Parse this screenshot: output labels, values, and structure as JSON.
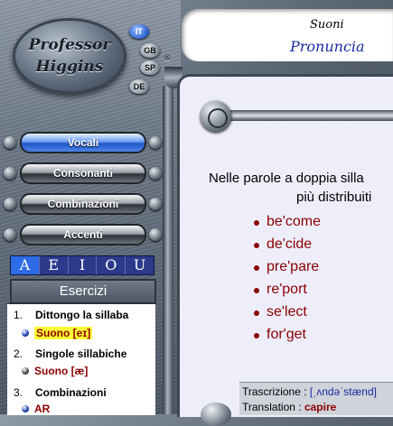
{
  "logo": {
    "line1": "Professor",
    "line2": "Higgins",
    "reg": "®"
  },
  "languages": [
    {
      "code": "IT",
      "active": true
    },
    {
      "code": "GB",
      "active": false
    },
    {
      "code": "SP",
      "active": false
    },
    {
      "code": "DE",
      "active": false
    }
  ],
  "nav": [
    {
      "label": "Vocali",
      "active": true
    },
    {
      "label": "Consonanti",
      "active": false
    },
    {
      "label": "Combinazioni",
      "active": false
    },
    {
      "label": "Accenti",
      "active": false
    }
  ],
  "letters": [
    "A",
    "E",
    "I",
    "O",
    "U"
  ],
  "selected_letter": "A",
  "esercizi_label": "Esercizi",
  "exercises": [
    {
      "num": "1.",
      "title": "Dittongo la sillaba",
      "sub": "Suono [eɪ]",
      "highlight": true
    },
    {
      "num": "2.",
      "title": "Singole sillabiche",
      "sub": "Suono [æ]",
      "highlight": false
    },
    {
      "num": "3.",
      "title": "Combinazioni",
      "sub": "AR",
      "highlight": false
    }
  ],
  "header": {
    "subtitle": "Suoni",
    "title": "Pronuncia"
  },
  "instruction": {
    "line1": "Nelle parole a doppia silla",
    "line2": "più distribuiti"
  },
  "words": [
    "be'come",
    "de'cide",
    "pre'pare",
    "re'port",
    "se'lect",
    "for'get"
  ],
  "footer": {
    "transcription_label": "Trascrizione :",
    "transcription_value": "[ˌʌndəˈstænd]",
    "translation_label": "Translation :",
    "translation_value": "capire"
  }
}
